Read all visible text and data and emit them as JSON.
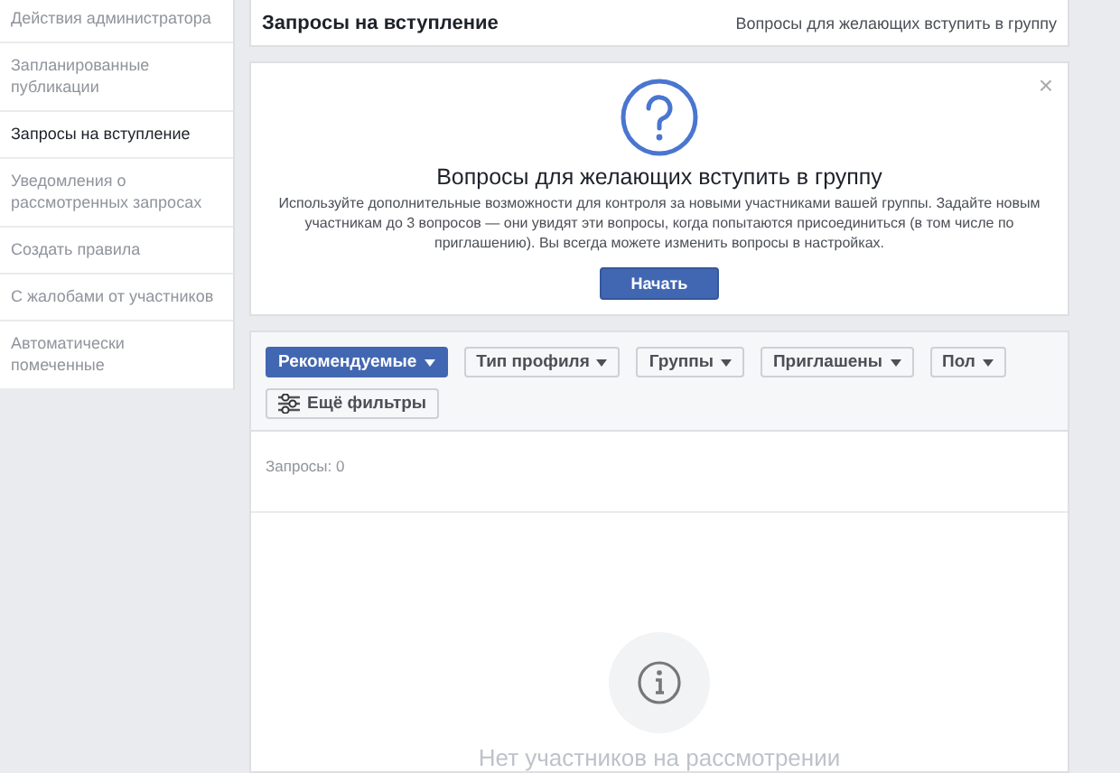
{
  "sidebar": {
    "items": [
      {
        "label": "Действия администратора",
        "selected": false
      },
      {
        "label": "Запланированные публикации",
        "selected": false
      },
      {
        "label": "Запросы на вступление",
        "selected": true
      },
      {
        "label": "Уведомления о рассмотренных запросах",
        "selected": false
      },
      {
        "label": "Создать правила",
        "selected": false
      },
      {
        "label": "С жалобами от участников",
        "selected": false
      },
      {
        "label": "Автоматически помеченные",
        "selected": false
      }
    ]
  },
  "header": {
    "title": "Запросы на вступление",
    "link": "Вопросы для желающих вступить в группу"
  },
  "promo": {
    "close": "×",
    "title": "Вопросы для желающих вступить в группу",
    "text": "Используйте дополнительные возможности для контроля за новыми участниками вашей группы. Задайте новым участникам до 3 вопросов — они увидят эти вопросы, когда попытаются присоединиться (в том числе по приглашению). Вы всегда можете изменить вопросы в настройках.",
    "button": "Начать"
  },
  "filters": [
    {
      "label": "Рекомендуемые",
      "selected": true
    },
    {
      "label": "Тип профиля",
      "selected": false
    },
    {
      "label": "Группы",
      "selected": false
    },
    {
      "label": "Приглашены",
      "selected": false
    },
    {
      "label": "Пол",
      "selected": false
    }
  ],
  "more_filters": "Ещё фильтры",
  "count": "Запросы: 0",
  "empty": "Нет участников на рассмотрении"
}
